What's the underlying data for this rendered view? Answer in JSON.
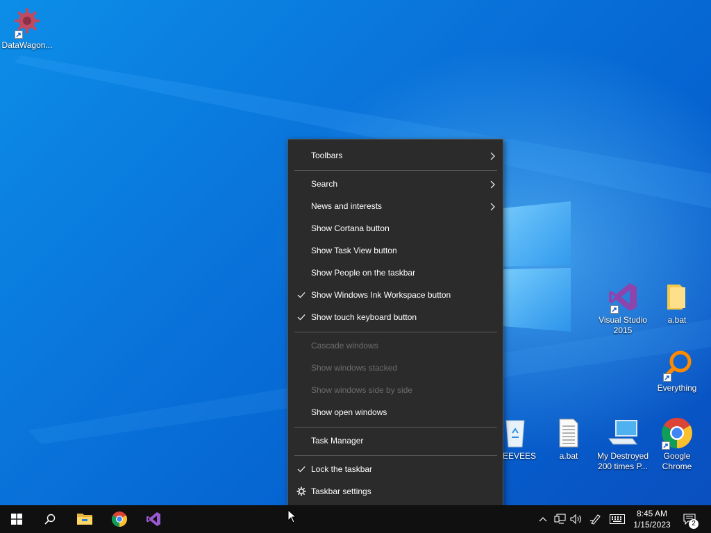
{
  "desktop_icons": [
    {
      "label": "DataWagon...",
      "icon": "datawagon-gear-icon"
    },
    {
      "label": "Visual Studio 2015",
      "icon": "visual-studio-icon"
    },
    {
      "label": "a.bat",
      "icon": "folder-icon"
    },
    {
      "label": "Everything",
      "icon": "everything-search-icon"
    },
    {
      "label": "re EEVEES",
      "icon": "recycle-bin-icon"
    },
    {
      "label": "a.bat",
      "icon": "batch-file-icon"
    },
    {
      "label": "My Destroyed 200 times P...",
      "icon": "this-pc-icon"
    },
    {
      "label": "Google Chrome",
      "icon": "chrome-icon"
    }
  ],
  "context_menu": {
    "items": [
      {
        "label": "Toolbars",
        "submenu": true,
        "checked": false,
        "enabled": true
      },
      {
        "label": "Search",
        "submenu": true,
        "checked": false,
        "enabled": true
      },
      {
        "label": "News and interests",
        "submenu": true,
        "checked": false,
        "enabled": true
      },
      {
        "label": "Show Cortana button",
        "submenu": false,
        "checked": false,
        "enabled": true
      },
      {
        "label": "Show Task View button",
        "submenu": false,
        "checked": false,
        "enabled": true
      },
      {
        "label": "Show People on the taskbar",
        "submenu": false,
        "checked": false,
        "enabled": true
      },
      {
        "label": "Show Windows Ink Workspace button",
        "submenu": false,
        "checked": true,
        "enabled": true
      },
      {
        "label": "Show touch keyboard button",
        "submenu": false,
        "checked": true,
        "enabled": true
      },
      {
        "label": "Cascade windows",
        "submenu": false,
        "checked": false,
        "enabled": false
      },
      {
        "label": "Show windows stacked",
        "submenu": false,
        "checked": false,
        "enabled": false
      },
      {
        "label": "Show windows side by side",
        "submenu": false,
        "checked": false,
        "enabled": false
      },
      {
        "label": "Show open windows",
        "submenu": false,
        "checked": false,
        "enabled": true
      },
      {
        "label": "Task Manager",
        "submenu": false,
        "checked": false,
        "enabled": true
      },
      {
        "label": "Lock the taskbar",
        "submenu": false,
        "checked": true,
        "enabled": true
      },
      {
        "label": "Taskbar settings",
        "submenu": false,
        "checked": false,
        "enabled": true,
        "icon": "gear-icon"
      }
    ]
  },
  "taskbar": {
    "pinned": [
      "start-icon",
      "search-icon",
      "file-explorer-icon",
      "chrome-icon",
      "visual-studio-icon"
    ],
    "tray_icons": [
      "chevron-up-icon",
      "network-icon",
      "volume-icon",
      "pen-icon",
      "keyboard-icon"
    ],
    "clock": {
      "time": "8:45 AM",
      "date": "1/15/2023"
    },
    "notifications_count": "2"
  },
  "colors": {
    "menu_bg": "#2b2b2b",
    "menu_disabled_text": "#6d6d6d",
    "taskbar_bg": "#101010",
    "desktop_blue": "#0a76dc"
  }
}
